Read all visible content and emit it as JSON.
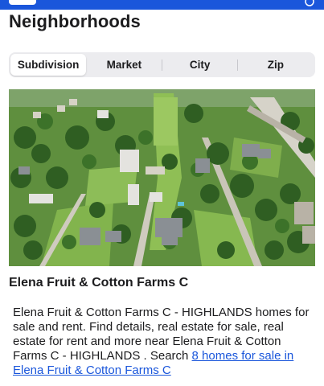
{
  "header": {
    "brand_color": "#1a56db",
    "logo_icon": "logo-icon",
    "user_icon": "user-icon"
  },
  "page_title": "Neighborhoods",
  "tabs": [
    {
      "label": "Subdivision",
      "active": true
    },
    {
      "label": "Market",
      "active": false
    },
    {
      "label": "City",
      "active": false
    },
    {
      "label": "Zip",
      "active": false
    }
  ],
  "photo": {
    "icon": "aerial-neighborhood-photo"
  },
  "neighborhood": {
    "name": "Elena Fruit & Cotton Farms C",
    "description": "Elena Fruit & Cotton Farms C - HIGHLANDS homes for sale and rent. Find details, real estate for sale, real estate for rent and more near Elena Fruit & Cotton Farms C - HIGHLANDS . Search ",
    "link_text": "8 homes for sale in Elena Fruit & Cotton Farms C"
  }
}
